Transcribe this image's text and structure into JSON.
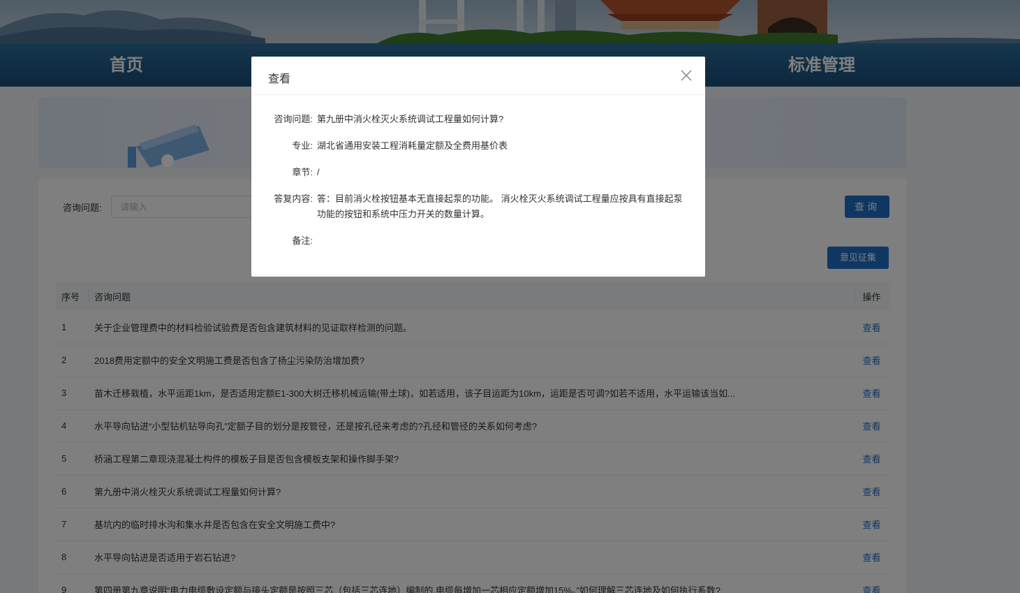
{
  "nav": {
    "items": [
      {
        "label": "首页"
      },
      {
        "label": "标准管理"
      }
    ]
  },
  "search": {
    "label": "咨询问题:",
    "placeholder": "请输入",
    "value": "",
    "button": "查询"
  },
  "list": {
    "feedback_button": "意见征集",
    "headers": {
      "index": "序号",
      "question": "咨询问题",
      "op": "操作"
    },
    "rows": [
      {
        "index": "1",
        "question": "关于企业管理费中的材料检验试验费是否包含建筑材料的见证取样检测的问题。",
        "op": "查看"
      },
      {
        "index": "2",
        "question": "2018费用定额中的安全文明施工费是否包含了扬尘污染防治增加费?",
        "op": "查看"
      },
      {
        "index": "3",
        "question": "苗木迁移栽植，水平运距1km，是否适用定额E1-300大树迁移机械运输(带土球)，如若适用，该子目运距为10km，运距是否可调?如若不适用，水平运输该当如...",
        "op": "查看"
      },
      {
        "index": "4",
        "question": "水平导向钻进“小型钻机钻导向孔”定额子目的划分是按管径，还是按孔径来考虑的?孔径和管径的关系如何考虑?",
        "op": "查看"
      },
      {
        "index": "5",
        "question": "桥涵工程第二章现浇混凝土构件的模板子目是否包含模板支架和操作脚手架?",
        "op": "查看"
      },
      {
        "index": "6",
        "question": "第九册中消火栓灭火系统调试工程量如何计算?",
        "op": "查看"
      },
      {
        "index": "7",
        "question": "基坑内的临时排水沟和集水井是否包含在安全文明施工费中?",
        "op": "查看"
      },
      {
        "index": "8",
        "question": "水平导向钻进是否适用于岩石钻进?",
        "op": "查看"
      },
      {
        "index": "9",
        "question": "第四册第九章说明“电力电缆敷设定额与接头定额是按照三芯（包括三芯连地）编制的,电缆每增加一芯相应定额增加15%。”如何理解三芯连地及如何执行系数?",
        "op": "查看"
      }
    ]
  },
  "dialog": {
    "title": "查看",
    "fields": [
      {
        "label": "咨询问题:",
        "value": "第九册中消火栓灭火系统调试工程量如何计算?"
      },
      {
        "label": "专业:",
        "value": "湖北省通用安装工程消耗量定额及全费用基价表"
      },
      {
        "label": "章节:",
        "value": "/"
      },
      {
        "label": "答复内容:",
        "value": "答：目前消火栓按钮基本无直接起泵的功能。 消火栓灭火系统调试工程量应按具有直接起泵功能的按钮和系统中压力开关的数量计算。"
      },
      {
        "label": "备注:",
        "value": ""
      }
    ]
  }
}
